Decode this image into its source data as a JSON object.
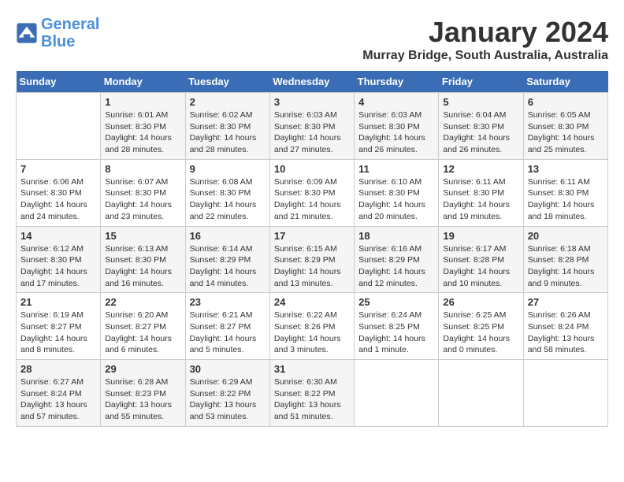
{
  "logo": {
    "line1": "General",
    "line2": "Blue"
  },
  "calendar": {
    "title": "January 2024",
    "subtitle": "Murray Bridge, South Australia, Australia"
  },
  "weekdays": [
    "Sunday",
    "Monday",
    "Tuesday",
    "Wednesday",
    "Thursday",
    "Friday",
    "Saturday"
  ],
  "weeks": [
    [
      {
        "day": "",
        "info": ""
      },
      {
        "day": "1",
        "info": "Sunrise: 6:01 AM\nSunset: 8:30 PM\nDaylight: 14 hours\nand 28 minutes."
      },
      {
        "day": "2",
        "info": "Sunrise: 6:02 AM\nSunset: 8:30 PM\nDaylight: 14 hours\nand 28 minutes."
      },
      {
        "day": "3",
        "info": "Sunrise: 6:03 AM\nSunset: 8:30 PM\nDaylight: 14 hours\nand 27 minutes."
      },
      {
        "day": "4",
        "info": "Sunrise: 6:03 AM\nSunset: 8:30 PM\nDaylight: 14 hours\nand 26 minutes."
      },
      {
        "day": "5",
        "info": "Sunrise: 6:04 AM\nSunset: 8:30 PM\nDaylight: 14 hours\nand 26 minutes."
      },
      {
        "day": "6",
        "info": "Sunrise: 6:05 AM\nSunset: 8:30 PM\nDaylight: 14 hours\nand 25 minutes."
      }
    ],
    [
      {
        "day": "7",
        "info": "Sunrise: 6:06 AM\nSunset: 8:30 PM\nDaylight: 14 hours\nand 24 minutes."
      },
      {
        "day": "8",
        "info": "Sunrise: 6:07 AM\nSunset: 8:30 PM\nDaylight: 14 hours\nand 23 minutes."
      },
      {
        "day": "9",
        "info": "Sunrise: 6:08 AM\nSunset: 8:30 PM\nDaylight: 14 hours\nand 22 minutes."
      },
      {
        "day": "10",
        "info": "Sunrise: 6:09 AM\nSunset: 8:30 PM\nDaylight: 14 hours\nand 21 minutes."
      },
      {
        "day": "11",
        "info": "Sunrise: 6:10 AM\nSunset: 8:30 PM\nDaylight: 14 hours\nand 20 minutes."
      },
      {
        "day": "12",
        "info": "Sunrise: 6:11 AM\nSunset: 8:30 PM\nDaylight: 14 hours\nand 19 minutes."
      },
      {
        "day": "13",
        "info": "Sunrise: 6:11 AM\nSunset: 8:30 PM\nDaylight: 14 hours\nand 18 minutes."
      }
    ],
    [
      {
        "day": "14",
        "info": "Sunrise: 6:12 AM\nSunset: 8:30 PM\nDaylight: 14 hours\nand 17 minutes."
      },
      {
        "day": "15",
        "info": "Sunrise: 6:13 AM\nSunset: 8:30 PM\nDaylight: 14 hours\nand 16 minutes."
      },
      {
        "day": "16",
        "info": "Sunrise: 6:14 AM\nSunset: 8:29 PM\nDaylight: 14 hours\nand 14 minutes."
      },
      {
        "day": "17",
        "info": "Sunrise: 6:15 AM\nSunset: 8:29 PM\nDaylight: 14 hours\nand 13 minutes."
      },
      {
        "day": "18",
        "info": "Sunrise: 6:16 AM\nSunset: 8:29 PM\nDaylight: 14 hours\nand 12 minutes."
      },
      {
        "day": "19",
        "info": "Sunrise: 6:17 AM\nSunset: 8:28 PM\nDaylight: 14 hours\nand 10 minutes."
      },
      {
        "day": "20",
        "info": "Sunrise: 6:18 AM\nSunset: 8:28 PM\nDaylight: 14 hours\nand 9 minutes."
      }
    ],
    [
      {
        "day": "21",
        "info": "Sunrise: 6:19 AM\nSunset: 8:27 PM\nDaylight: 14 hours\nand 8 minutes."
      },
      {
        "day": "22",
        "info": "Sunrise: 6:20 AM\nSunset: 8:27 PM\nDaylight: 14 hours\nand 6 minutes."
      },
      {
        "day": "23",
        "info": "Sunrise: 6:21 AM\nSunset: 8:27 PM\nDaylight: 14 hours\nand 5 minutes."
      },
      {
        "day": "24",
        "info": "Sunrise: 6:22 AM\nSunset: 8:26 PM\nDaylight: 14 hours\nand 3 minutes."
      },
      {
        "day": "25",
        "info": "Sunrise: 6:24 AM\nSunset: 8:25 PM\nDaylight: 14 hours\nand 1 minute."
      },
      {
        "day": "26",
        "info": "Sunrise: 6:25 AM\nSunset: 8:25 PM\nDaylight: 14 hours\nand 0 minutes."
      },
      {
        "day": "27",
        "info": "Sunrise: 6:26 AM\nSunset: 8:24 PM\nDaylight: 13 hours\nand 58 minutes."
      }
    ],
    [
      {
        "day": "28",
        "info": "Sunrise: 6:27 AM\nSunset: 8:24 PM\nDaylight: 13 hours\nand 57 minutes."
      },
      {
        "day": "29",
        "info": "Sunrise: 6:28 AM\nSunset: 8:23 PM\nDaylight: 13 hours\nand 55 minutes."
      },
      {
        "day": "30",
        "info": "Sunrise: 6:29 AM\nSunset: 8:22 PM\nDaylight: 13 hours\nand 53 minutes."
      },
      {
        "day": "31",
        "info": "Sunrise: 6:30 AM\nSunset: 8:22 PM\nDaylight: 13 hours\nand 51 minutes."
      },
      {
        "day": "",
        "info": ""
      },
      {
        "day": "",
        "info": ""
      },
      {
        "day": "",
        "info": ""
      }
    ]
  ]
}
